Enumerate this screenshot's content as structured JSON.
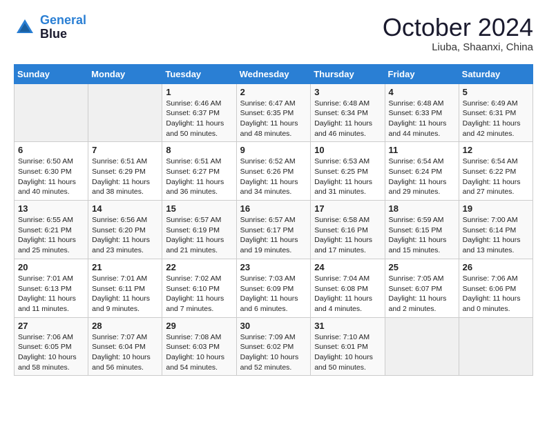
{
  "header": {
    "logo_line1": "General",
    "logo_line2": "Blue",
    "month": "October 2024",
    "location": "Liuba, Shaanxi, China"
  },
  "weekdays": [
    "Sunday",
    "Monday",
    "Tuesday",
    "Wednesday",
    "Thursday",
    "Friday",
    "Saturday"
  ],
  "weeks": [
    [
      {
        "day": "",
        "info": ""
      },
      {
        "day": "",
        "info": ""
      },
      {
        "day": "1",
        "info": "Sunrise: 6:46 AM\nSunset: 6:37 PM\nDaylight: 11 hours and 50 minutes."
      },
      {
        "day": "2",
        "info": "Sunrise: 6:47 AM\nSunset: 6:35 PM\nDaylight: 11 hours and 48 minutes."
      },
      {
        "day": "3",
        "info": "Sunrise: 6:48 AM\nSunset: 6:34 PM\nDaylight: 11 hours and 46 minutes."
      },
      {
        "day": "4",
        "info": "Sunrise: 6:48 AM\nSunset: 6:33 PM\nDaylight: 11 hours and 44 minutes."
      },
      {
        "day": "5",
        "info": "Sunrise: 6:49 AM\nSunset: 6:31 PM\nDaylight: 11 hours and 42 minutes."
      }
    ],
    [
      {
        "day": "6",
        "info": "Sunrise: 6:50 AM\nSunset: 6:30 PM\nDaylight: 11 hours and 40 minutes."
      },
      {
        "day": "7",
        "info": "Sunrise: 6:51 AM\nSunset: 6:29 PM\nDaylight: 11 hours and 38 minutes."
      },
      {
        "day": "8",
        "info": "Sunrise: 6:51 AM\nSunset: 6:27 PM\nDaylight: 11 hours and 36 minutes."
      },
      {
        "day": "9",
        "info": "Sunrise: 6:52 AM\nSunset: 6:26 PM\nDaylight: 11 hours and 34 minutes."
      },
      {
        "day": "10",
        "info": "Sunrise: 6:53 AM\nSunset: 6:25 PM\nDaylight: 11 hours and 31 minutes."
      },
      {
        "day": "11",
        "info": "Sunrise: 6:54 AM\nSunset: 6:24 PM\nDaylight: 11 hours and 29 minutes."
      },
      {
        "day": "12",
        "info": "Sunrise: 6:54 AM\nSunset: 6:22 PM\nDaylight: 11 hours and 27 minutes."
      }
    ],
    [
      {
        "day": "13",
        "info": "Sunrise: 6:55 AM\nSunset: 6:21 PM\nDaylight: 11 hours and 25 minutes."
      },
      {
        "day": "14",
        "info": "Sunrise: 6:56 AM\nSunset: 6:20 PM\nDaylight: 11 hours and 23 minutes."
      },
      {
        "day": "15",
        "info": "Sunrise: 6:57 AM\nSunset: 6:19 PM\nDaylight: 11 hours and 21 minutes."
      },
      {
        "day": "16",
        "info": "Sunrise: 6:57 AM\nSunset: 6:17 PM\nDaylight: 11 hours and 19 minutes."
      },
      {
        "day": "17",
        "info": "Sunrise: 6:58 AM\nSunset: 6:16 PM\nDaylight: 11 hours and 17 minutes."
      },
      {
        "day": "18",
        "info": "Sunrise: 6:59 AM\nSunset: 6:15 PM\nDaylight: 11 hours and 15 minutes."
      },
      {
        "day": "19",
        "info": "Sunrise: 7:00 AM\nSunset: 6:14 PM\nDaylight: 11 hours and 13 minutes."
      }
    ],
    [
      {
        "day": "20",
        "info": "Sunrise: 7:01 AM\nSunset: 6:13 PM\nDaylight: 11 hours and 11 minutes."
      },
      {
        "day": "21",
        "info": "Sunrise: 7:01 AM\nSunset: 6:11 PM\nDaylight: 11 hours and 9 minutes."
      },
      {
        "day": "22",
        "info": "Sunrise: 7:02 AM\nSunset: 6:10 PM\nDaylight: 11 hours and 7 minutes."
      },
      {
        "day": "23",
        "info": "Sunrise: 7:03 AM\nSunset: 6:09 PM\nDaylight: 11 hours and 6 minutes."
      },
      {
        "day": "24",
        "info": "Sunrise: 7:04 AM\nSunset: 6:08 PM\nDaylight: 11 hours and 4 minutes."
      },
      {
        "day": "25",
        "info": "Sunrise: 7:05 AM\nSunset: 6:07 PM\nDaylight: 11 hours and 2 minutes."
      },
      {
        "day": "26",
        "info": "Sunrise: 7:06 AM\nSunset: 6:06 PM\nDaylight: 11 hours and 0 minutes."
      }
    ],
    [
      {
        "day": "27",
        "info": "Sunrise: 7:06 AM\nSunset: 6:05 PM\nDaylight: 10 hours and 58 minutes."
      },
      {
        "day": "28",
        "info": "Sunrise: 7:07 AM\nSunset: 6:04 PM\nDaylight: 10 hours and 56 minutes."
      },
      {
        "day": "29",
        "info": "Sunrise: 7:08 AM\nSunset: 6:03 PM\nDaylight: 10 hours and 54 minutes."
      },
      {
        "day": "30",
        "info": "Sunrise: 7:09 AM\nSunset: 6:02 PM\nDaylight: 10 hours and 52 minutes."
      },
      {
        "day": "31",
        "info": "Sunrise: 7:10 AM\nSunset: 6:01 PM\nDaylight: 10 hours and 50 minutes."
      },
      {
        "day": "",
        "info": ""
      },
      {
        "day": "",
        "info": ""
      }
    ]
  ]
}
